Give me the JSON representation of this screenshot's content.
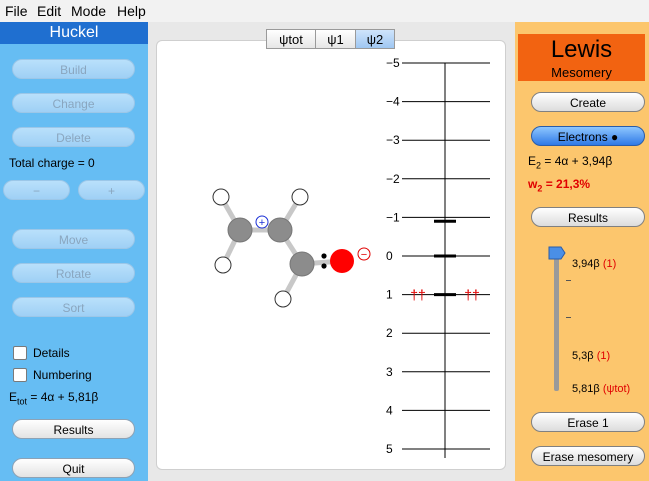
{
  "menu": [
    "File",
    "Edit",
    "Mode",
    "Help"
  ],
  "left": {
    "title": "Huckel",
    "build": "Build",
    "change": "Change",
    "delete": "Delete",
    "total_charge": "Total charge = 0",
    "minus": "−",
    "plus": "+",
    "move": "Move",
    "rotate": "Rotate",
    "sort": "Sort",
    "details": "Details",
    "numbering": "Numbering",
    "etot_prefix": "E",
    "etot_sub": "tot",
    "etot_value": " = 4α + 5,81β",
    "results": "Results",
    "quit": "Quit"
  },
  "tabs": [
    "ψtot",
    "ψ1",
    "ψ2"
  ],
  "active_tab": 2,
  "molecule": {
    "plus_charge": "+",
    "minus_charge": "−"
  },
  "energy_axis": {
    "labels": [
      "−5",
      "−4",
      "−3",
      "−2",
      "−1",
      "0",
      "1",
      "2",
      "3",
      "4",
      "5"
    ],
    "levels": [
      -0.9,
      0,
      1
    ],
    "occupied_marks": "††"
  },
  "right": {
    "lewis_title": "Lewis",
    "mesomery": "Mesomery",
    "create": "Create",
    "electrons": "Electrons ●",
    "e2_prefix": "E",
    "e2_sub": "2",
    "e2_value": " = 4α + 3,94β",
    "w2_prefix": "w",
    "w2_sub": "2",
    "w2_value": " = 21,3%",
    "results": "Results",
    "slider_items": [
      {
        "value": "3,94β",
        "tag": "(1)"
      },
      {
        "value": "5,3β",
        "tag": "(1)"
      },
      {
        "value": "5,81β",
        "tag": "(ψtot)"
      }
    ],
    "erase1": "Erase 1",
    "erase_mesomery": "Erase mesomery"
  },
  "colors": {
    "left_panel": "#66bdf3",
    "left_title": "#1f6fd0",
    "right_panel": "#fcc66d",
    "lewis_box": "#f26311",
    "carbon": "#8c8c8c",
    "oxygen": "#ff0000",
    "plus_charge": "#1a2fd6",
    "minus_charge": "#e00000",
    "electron_marks": "#e00000"
  }
}
